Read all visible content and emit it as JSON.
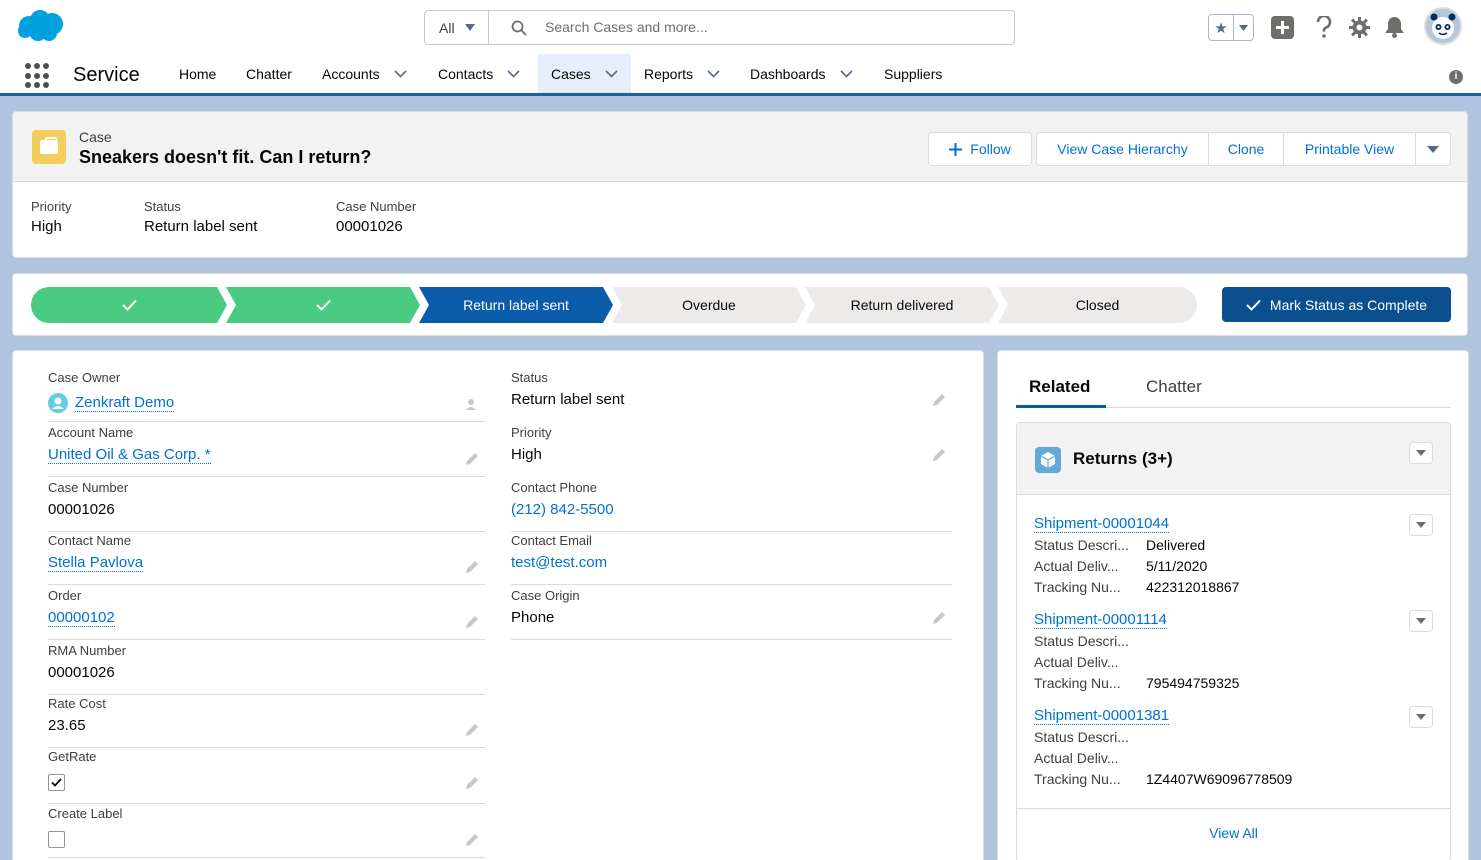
{
  "search": {
    "scope": "All",
    "placeholder": "Search Cases and more..."
  },
  "nav": {
    "app_name": "Service",
    "items": [
      {
        "label": "Home"
      },
      {
        "label": "Chatter"
      },
      {
        "label": "Accounts"
      },
      {
        "label": "Contacts"
      },
      {
        "label": "Cases"
      },
      {
        "label": "Reports"
      },
      {
        "label": "Dashboards"
      },
      {
        "label": "Suppliers"
      }
    ],
    "active": "Cases"
  },
  "record": {
    "object_type": "Case",
    "title": "Sneakers doesn't fit. Can I return?",
    "actions": {
      "follow": "Follow",
      "hierarchy": "View Case Hierarchy",
      "clone": "Clone",
      "printable": "Printable View"
    },
    "highlights": [
      {
        "label": "Priority",
        "value": "High"
      },
      {
        "label": "Status",
        "value": "Return label sent"
      },
      {
        "label": "Case Number",
        "value": "00001026"
      }
    ]
  },
  "path": {
    "stages": [
      {
        "label": "",
        "state": "complete"
      },
      {
        "label": "",
        "state": "complete"
      },
      {
        "label": "Return label sent",
        "state": "current"
      },
      {
        "label": "Overdue",
        "state": "incomplete"
      },
      {
        "label": "Return delivered",
        "state": "incomplete"
      },
      {
        "label": "Closed",
        "state": "incomplete"
      }
    ],
    "mark_button": "Mark Status as Complete"
  },
  "details": {
    "left": [
      {
        "label": "Case Owner",
        "value": "Zenkraft Demo"
      },
      {
        "label": "Account Name",
        "value": "United Oil & Gas Corp. *"
      },
      {
        "label": "Case Number",
        "value": "00001026"
      },
      {
        "label": "Contact Name",
        "value": "Stella Pavlova"
      },
      {
        "label": "Order",
        "value": "00000102"
      },
      {
        "label": "RMA Number",
        "value": "00001026"
      },
      {
        "label": "Rate Cost",
        "value": "23.65"
      },
      {
        "label": "GetRate",
        "checked": true
      },
      {
        "label": "Create Label",
        "checked": false
      }
    ],
    "right": [
      {
        "label": "Status",
        "value": "Return label sent"
      },
      {
        "label": "Priority",
        "value": "High"
      },
      {
        "label": "Contact Phone",
        "value": "(212) 842-5500"
      },
      {
        "label": "Contact Email",
        "value": "test@test.com"
      },
      {
        "label": "Case Origin",
        "value": "Phone"
      }
    ]
  },
  "related": {
    "tabs": [
      {
        "label": "Related"
      },
      {
        "label": "Chatter"
      }
    ],
    "active_tab": "Related",
    "list_title": "Returns (3+)",
    "field_labels": {
      "status": "Status Descri...",
      "delivery": "Actual Deliv...",
      "tracking": "Tracking Nu..."
    },
    "shipments": [
      {
        "name": "Shipment-00001044",
        "status": "Delivered",
        "delivery": "5/11/2020",
        "tracking": "422312018867"
      },
      {
        "name": "Shipment-00001114",
        "status": "",
        "delivery": "",
        "tracking": "795494759325"
      },
      {
        "name": "Shipment-00001381",
        "status": "",
        "delivery": "",
        "tracking": "1Z4407W69096778509"
      }
    ],
    "view_all": "View All"
  },
  "colors": {
    "brand": "#0070d2",
    "path_complete": "#4bca81",
    "path_current": "#0b5cab",
    "nav_active_bar": "#1b5fa8"
  }
}
